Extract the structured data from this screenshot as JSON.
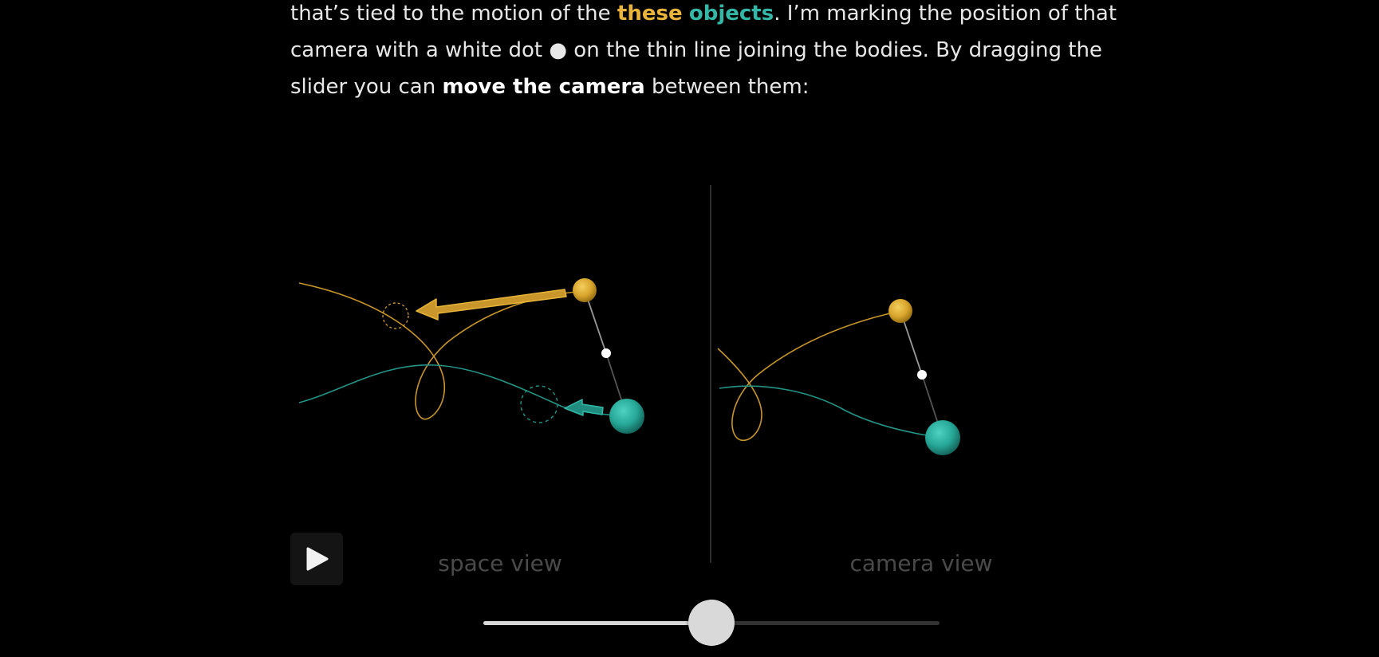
{
  "paragraph": {
    "line1_pre": "that’s tied to the motion of the ",
    "line1_yellow": "these",
    "line1_space": " ",
    "line1_teal": "objects",
    "line1_post": ". I’m marking the position of that",
    "line2": "camera with a white dot ● on the thin line joining the bodies. By dragging the",
    "line3_pre": "slider you can ",
    "line3_bold": "move the camera",
    "line3_post": " between them:"
  },
  "figure": {
    "space_view_label": "space view",
    "camera_view_label": "camera view",
    "play_button_icon": "play-icon",
    "slider_value": 0.5
  },
  "colors": {
    "yellow": "#e8b43a",
    "teal": "#33b8a8",
    "background": "#000000"
  }
}
